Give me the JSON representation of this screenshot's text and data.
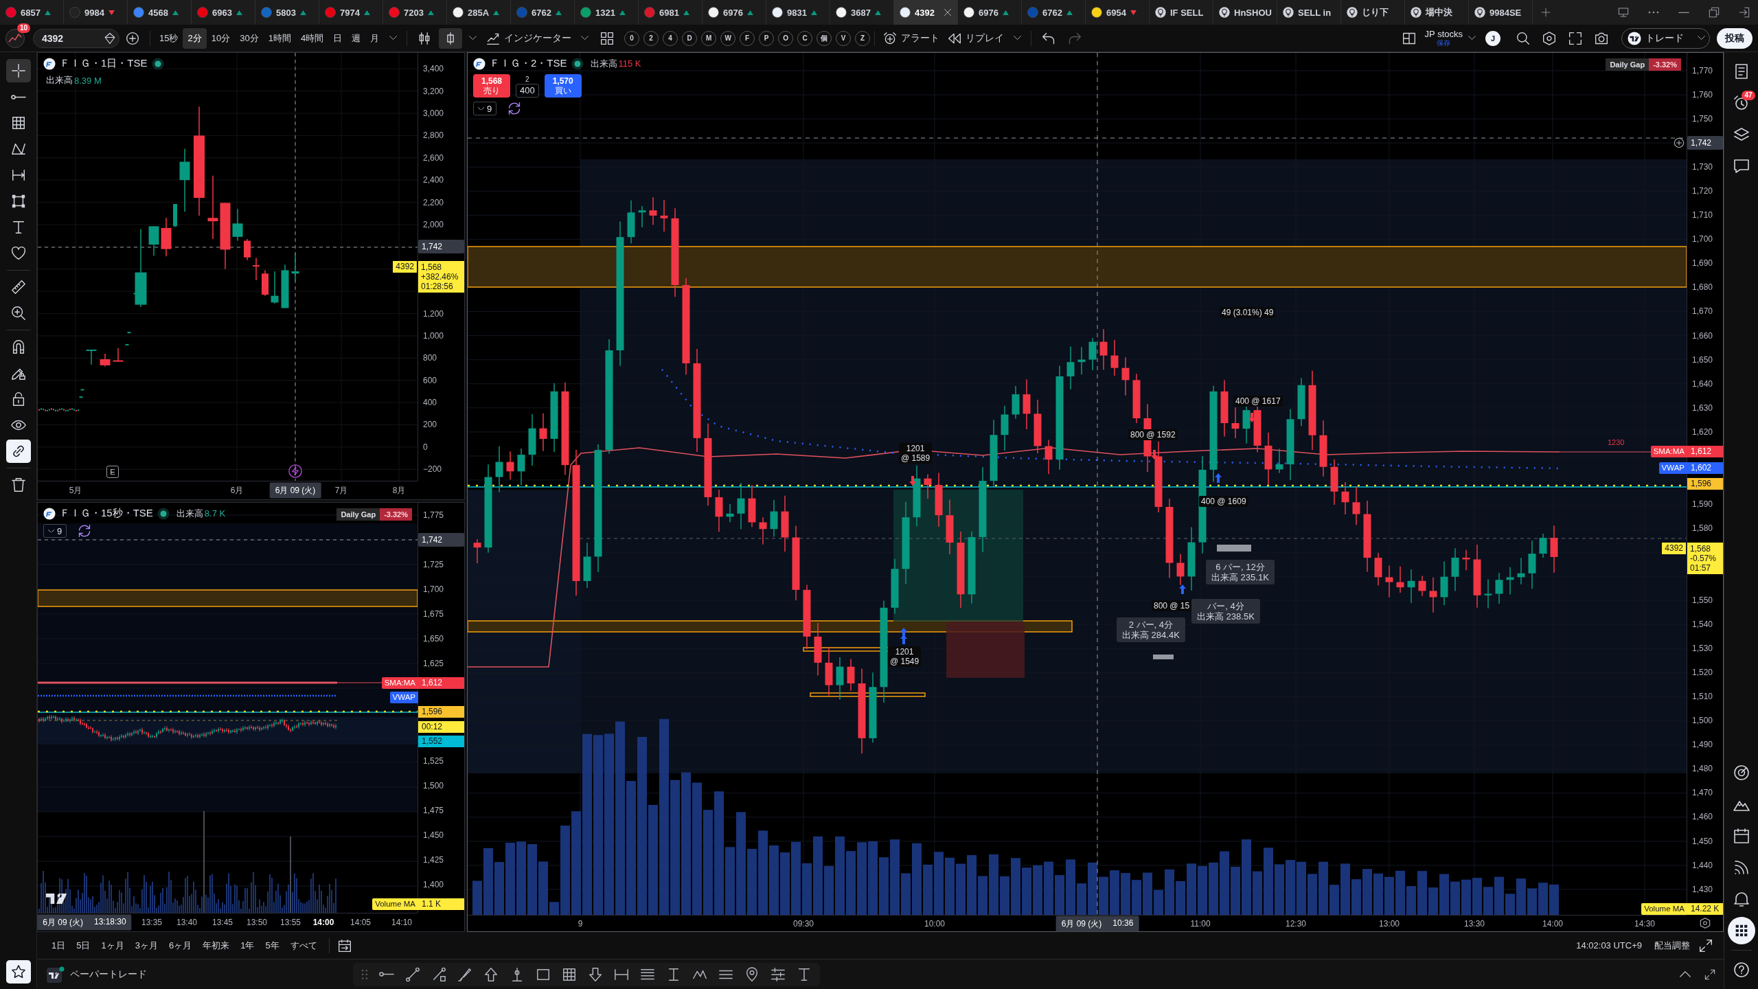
{
  "tabs": [
    {
      "kind": "symbol",
      "code": "6857",
      "rising": true,
      "color": "#e4002b",
      "selected": false
    },
    {
      "kind": "symbol",
      "code": "9984",
      "rising": false,
      "color": "#222222",
      "selected": false
    },
    {
      "kind": "symbol",
      "code": "4568",
      "rising": true,
      "color": "#3b82f6",
      "selected": false
    },
    {
      "kind": "symbol",
      "code": "6963",
      "rising": true,
      "color": "#e60012",
      "selected": false
    },
    {
      "kind": "symbol",
      "code": "5803",
      "rising": true,
      "color": "#1565c0",
      "selected": false
    },
    {
      "kind": "symbol",
      "code": "7974",
      "rising": true,
      "color": "#e60013",
      "selected": false
    },
    {
      "kind": "symbol",
      "code": "7203",
      "rising": true,
      "color": "#eb0a1e",
      "selected": false
    },
    {
      "kind": "symbol",
      "code": "285A",
      "rising": true,
      "color": "#f2f2f2",
      "selected": false
    },
    {
      "kind": "symbol",
      "code": "6762",
      "rising": true,
      "color": "#0a4aa6",
      "selected": false
    },
    {
      "kind": "symbol",
      "code": "1321",
      "rising": true,
      "color": "#0b9e6a",
      "selected": false
    },
    {
      "kind": "symbol",
      "code": "6981",
      "rising": true,
      "color": "#d7182a",
      "selected": false
    },
    {
      "kind": "symbol",
      "code": "6976",
      "rising": true,
      "color": "#f3f3f3",
      "selected": false
    },
    {
      "kind": "symbol",
      "code": "9831",
      "rising": true,
      "color": "#e9eef8",
      "selected": false
    },
    {
      "kind": "symbol",
      "code": "3687",
      "rising": true,
      "color": "#f5f5f5",
      "selected": false
    },
    {
      "kind": "symbol",
      "code": "4392",
      "color": "#e8f1fb",
      "selected": true
    },
    {
      "kind": "symbol",
      "code": "6976",
      "rising": true,
      "color": "#f3f3f3",
      "selected": false
    },
    {
      "kind": "symbol",
      "code": "6762",
      "rising": true,
      "color": "#0a4aa6",
      "selected": false
    },
    {
      "kind": "symbol",
      "code": "6954",
      "rising": false,
      "color": "#f7d117",
      "selected": false
    },
    {
      "kind": "script",
      "label": "IF SELL",
      "selected": false
    },
    {
      "kind": "script",
      "label": "HnSHOU",
      "selected": false
    },
    {
      "kind": "script",
      "label": "SELL in",
      "selected": false
    },
    {
      "kind": "script",
      "label": "じり下",
      "selected": false
    },
    {
      "kind": "script",
      "label": "場中決",
      "selected": false
    },
    {
      "kind": "script",
      "label": "9984SE",
      "selected": false
    }
  ],
  "toolbar": {
    "avatar_badge": "10",
    "symbol": "4392",
    "intervals": [
      {
        "label": "15秒",
        "selected": false
      },
      {
        "label": "2分",
        "selected": true
      },
      {
        "label": "10分",
        "selected": false
      },
      {
        "label": "30分",
        "selected": false
      },
      {
        "label": "1時間",
        "selected": false
      },
      {
        "label": "4時間",
        "selected": false
      },
      {
        "label": "日",
        "selected": false
      },
      {
        "label": "週",
        "selected": false
      },
      {
        "label": "月",
        "selected": false
      }
    ],
    "chart_styles": [
      {
        "kind": "candles",
        "selected": false
      },
      {
        "kind": "hollow",
        "selected": true
      }
    ],
    "indicators": "インジケーター",
    "quick_buttons": [
      "0",
      "2",
      "4",
      "D",
      "M",
      "W",
      "F",
      "P",
      "O",
      "C",
      "個",
      "V",
      "Z"
    ],
    "alert": "アラート",
    "replay": "リプレイ",
    "layout": {
      "name": "JP stocks",
      "status": "保存"
    },
    "user_initial": "J",
    "trade": "トレード",
    "publish": "投稿"
  },
  "drawing_tools": [
    [
      {
        "kind": "crosshair",
        "selected": true
      },
      {
        "kind": "line",
        "selected": false
      },
      {
        "kind": "fib",
        "selected": false
      },
      {
        "kind": "pattern",
        "selected": false
      },
      {
        "kind": "measure",
        "selected": false
      },
      {
        "kind": "rect",
        "selected": false
      },
      {
        "kind": "text",
        "selected": false
      },
      {
        "kind": "heart",
        "selected": false
      }
    ],
    [
      {
        "kind": "ruler",
        "selected": false
      },
      {
        "kind": "zoom",
        "selected": false
      }
    ],
    [
      {
        "kind": "magnet",
        "selected": false,
        "on": false
      },
      {
        "kind": "pencillock",
        "selected": false,
        "on": false
      },
      {
        "kind": "lock",
        "selected": false,
        "on": false
      },
      {
        "kind": "eye",
        "selected": false,
        "on": false
      },
      {
        "kind": "link",
        "selected": false,
        "on": true
      }
    ],
    [
      {
        "kind": "trash",
        "selected": false
      }
    ],
    [
      {
        "kind": "star",
        "selected": false,
        "on": true
      }
    ]
  ],
  "daily_chart": {
    "title": "ＦＩＧ・1日・TSE",
    "live": true,
    "volume_label": "出来高",
    "volume_value": "8.39 M",
    "volume_rising": true,
    "earnings_marker": "E",
    "price_axis": [
      {
        "kind": "tick",
        "label": "3,400"
      },
      {
        "kind": "tick",
        "label": "3,200"
      },
      {
        "kind": "tick",
        "label": "3,000"
      },
      {
        "kind": "tick",
        "label": "2,800"
      },
      {
        "kind": "tick",
        "label": "2,600"
      },
      {
        "kind": "tick",
        "label": "2,400"
      },
      {
        "kind": "tick",
        "label": "2,200"
      },
      {
        "kind": "tick",
        "label": "2,000"
      },
      {
        "kind": "crosshair",
        "label": "1,742"
      },
      {
        "kind": "last",
        "symbol": "4392",
        "lines": [
          "1,568",
          "+382.46%",
          "01:28:56"
        ],
        "color": "#ffeb3b"
      },
      {
        "kind": "tick",
        "label": "1,200"
      },
      {
        "kind": "tick",
        "label": "1,000"
      },
      {
        "kind": "tick",
        "label": "800"
      },
      {
        "kind": "tick",
        "label": "600"
      },
      {
        "kind": "tick",
        "label": "400"
      },
      {
        "kind": "tick",
        "label": "200"
      },
      {
        "kind": "tick",
        "label": "0"
      },
      {
        "kind": "tick",
        "label": "−200"
      }
    ],
    "time_axis": [
      {
        "kind": "tick",
        "label": "5月"
      },
      {
        "kind": "tick",
        "label": "6月"
      },
      {
        "kind": "crosshair",
        "date": "6月 09 (火)"
      },
      {
        "kind": "tick",
        "label": "7月"
      },
      {
        "kind": "tick",
        "label": "8月"
      }
    ]
  },
  "intraday_chart": {
    "title": "ＦＩＧ・15秒・TSE",
    "live": true,
    "volume_label": "出来高",
    "volume_value": "8.7 K",
    "volume_rising": true,
    "collapsed_count": "9",
    "daily_gap": {
      "label": "Daily Gap",
      "value": "-3.32%"
    },
    "price_axis": [
      {
        "kind": "tick",
        "label": "1,775"
      },
      {
        "kind": "crosshair",
        "label": "1,742"
      },
      {
        "kind": "tick",
        "label": "1,725"
      },
      {
        "kind": "tick",
        "label": "1,700"
      },
      {
        "kind": "tick",
        "label": "1,675"
      },
      {
        "kind": "tick",
        "label": "1,650"
      },
      {
        "kind": "tick",
        "label": "1,625"
      },
      {
        "kind": "marker",
        "name": "SMA:MA",
        "value": "1,612",
        "color": "#f23645"
      },
      {
        "kind": "marker",
        "name": "VWAP",
        "color": "#2962ff"
      },
      {
        "kind": "marker",
        "value": "1,596",
        "color": "#f9c22e"
      },
      {
        "kind": "marker",
        "value": "00:12",
        "color": "#ffeb3b"
      },
      {
        "kind": "marker",
        "value": "1,552",
        "color": "#00bcd4"
      },
      {
        "kind": "tick",
        "label": "1,525"
      },
      {
        "kind": "tick",
        "label": "1,500"
      },
      {
        "kind": "tick",
        "label": "1,475"
      },
      {
        "kind": "tick",
        "label": "1,450"
      },
      {
        "kind": "tick",
        "label": "1,425"
      },
      {
        "kind": "tick",
        "label": "1,400"
      },
      {
        "kind": "marker",
        "name": "Volume MA",
        "value": "1.1 K",
        "color": "#ffeb3b"
      }
    ],
    "time_axis": [
      {
        "kind": "crosshair",
        "date": "6月 09 (火)",
        "time": "13:18:30"
      },
      {
        "kind": "tick",
        "label": "13:35",
        "major": false
      },
      {
        "kind": "tick",
        "label": "13:40",
        "major": false
      },
      {
        "kind": "tick",
        "label": "13:45",
        "major": false
      },
      {
        "kind": "tick",
        "label": "13:50",
        "major": false
      },
      {
        "kind": "tick",
        "label": "13:55",
        "major": false
      },
      {
        "kind": "tick",
        "label": "14:00",
        "major": true
      },
      {
        "kind": "tick",
        "label": "14:05",
        "major": false
      },
      {
        "kind": "tick",
        "label": "14:10",
        "major": false
      }
    ]
  },
  "main_chart": {
    "title": "ＦＩＧ・2・TSE",
    "live": true,
    "volume_label": "出来高",
    "volume_value": "115 K",
    "volume_rising": false,
    "order_panel": {
      "sell_price": "1,568",
      "sell_label": "売り",
      "spread": "2",
      "quantity": "400",
      "buy_price": "1,570",
      "buy_label": "買い"
    },
    "collapsed_count": "9",
    "daily_gap": {
      "label": "Daily Gap",
      "value": "-3.32%"
    },
    "annotations": [
      {
        "kind": "label",
        "lines": [
          "49 (3.01%) 49"
        ]
      },
      {
        "kind": "label",
        "lines": [
          "400 @ 1617"
        ]
      },
      {
        "kind": "label",
        "lines": [
          "800 @ 1592"
        ]
      },
      {
        "kind": "label",
        "lines": [
          "400 @ 1609"
        ]
      },
      {
        "kind": "label",
        "lines": [
          "1201",
          "@ 1589"
        ]
      },
      {
        "kind": "label",
        "lines": [
          "1201",
          "@ 1549"
        ]
      },
      {
        "kind": "stats",
        "lines": [
          "6 バー, 12分",
          "出来高 235.1K"
        ]
      },
      {
        "kind": "label",
        "lines": [
          "800 @ 15"
        ]
      },
      {
        "kind": "stats",
        "lines": [
          "バー, 4分",
          "出来高 238.5K"
        ]
      },
      {
        "kind": "stats",
        "lines": [
          "2 バー, 4分",
          "出来高 284.4K"
        ]
      },
      {
        "kind": "note",
        "lines": [
          "1230"
        ]
      }
    ],
    "price_axis": [
      {
        "kind": "tick",
        "label": "1,770"
      },
      {
        "kind": "tick",
        "label": "1,760"
      },
      {
        "kind": "tick",
        "label": "1,750"
      },
      {
        "kind": "crosshair",
        "label": "1,742"
      },
      {
        "kind": "tick",
        "label": "1,730"
      },
      {
        "kind": "tick",
        "label": "1,720"
      },
      {
        "kind": "tick",
        "label": "1,710"
      },
      {
        "kind": "tick",
        "label": "1,700"
      },
      {
        "kind": "tick",
        "label": "1,690"
      },
      {
        "kind": "tick",
        "label": "1,680"
      },
      {
        "kind": "tick",
        "label": "1,670"
      },
      {
        "kind": "tick",
        "label": "1,660"
      },
      {
        "kind": "tick",
        "label": "1,650"
      },
      {
        "kind": "tick",
        "label": "1,640"
      },
      {
        "kind": "tick",
        "label": "1,630"
      },
      {
        "kind": "tick",
        "label": "1,620"
      },
      {
        "kind": "marker",
        "name": "SMA:MA",
        "value": "1,612",
        "color": "#f23645"
      },
      {
        "kind": "marker",
        "name": "VWAP",
        "value": "1,602",
        "color": "#2962ff"
      },
      {
        "kind": "marker",
        "value": "1,596",
        "color": "#f9c22e"
      },
      {
        "kind": "tick",
        "label": "1,590"
      },
      {
        "kind": "tick",
        "label": "1,580"
      },
      {
        "kind": "last",
        "symbol": "4392",
        "lines": [
          "1,568",
          "-0.57%",
          "01:57"
        ],
        "color": "#ffeb3b"
      },
      {
        "kind": "tick",
        "label": "1,550"
      },
      {
        "kind": "tick",
        "label": "1,540"
      },
      {
        "kind": "tick",
        "label": "1,530"
      },
      {
        "kind": "tick",
        "label": "1,520"
      },
      {
        "kind": "tick",
        "label": "1,510"
      },
      {
        "kind": "tick",
        "label": "1,500"
      },
      {
        "kind": "tick",
        "label": "1,490"
      },
      {
        "kind": "tick",
        "label": "1,480"
      },
      {
        "kind": "tick",
        "label": "1,470"
      },
      {
        "kind": "tick",
        "label": "1,460"
      },
      {
        "kind": "tick",
        "label": "1,450"
      },
      {
        "kind": "tick",
        "label": "1,440"
      },
      {
        "kind": "tick",
        "label": "1,430"
      },
      {
        "kind": "marker",
        "name": "Volume MA",
        "value": "14.22 K",
        "color": "#ffeb3b"
      }
    ],
    "time_axis": [
      {
        "kind": "tick",
        "label": "9"
      },
      {
        "kind": "tick",
        "label": "09:30"
      },
      {
        "kind": "tick",
        "label": "10:00"
      },
      {
        "kind": "crosshair",
        "date": "6月 09 (火)",
        "time": "10:36"
      },
      {
        "kind": "tick",
        "label": "11:00"
      },
      {
        "kind": "tick",
        "label": "12:30"
      },
      {
        "kind": "tick",
        "label": "13:00"
      },
      {
        "kind": "tick",
        "label": "13:30"
      },
      {
        "kind": "tick",
        "label": "14:00"
      },
      {
        "kind": "tick",
        "label": "14:30"
      }
    ]
  },
  "range_bar": {
    "ranges": [
      "1日",
      "5日",
      "1ヶ月",
      "3ヶ月",
      "6ヶ月",
      "年初来",
      "1年",
      "5年",
      "すべて"
    ],
    "clock": "14:02:03 UTC+9",
    "adjustment": "配当調整"
  },
  "paper_trading": {
    "label": "ペーパートレード"
  },
  "sidebar": [
    [
      {
        "kind": "watchlist",
        "selected": false
      },
      {
        "kind": "alarm",
        "selected": false,
        "badge": "47"
      },
      {
        "kind": "layers",
        "selected": false
      },
      {
        "kind": "chat",
        "selected": false
      }
    ],
    [
      {
        "kind": "target",
        "selected": false
      },
      {
        "kind": "mountains",
        "selected": false
      },
      {
        "kind": "calendar",
        "selected": false
      },
      {
        "kind": "broadcast",
        "selected": false
      },
      {
        "kind": "bell",
        "selected": false
      },
      {
        "kind": "apps",
        "selected": true
      }
    ],
    [
      {
        "kind": "help",
        "selected": false
      }
    ]
  ]
}
